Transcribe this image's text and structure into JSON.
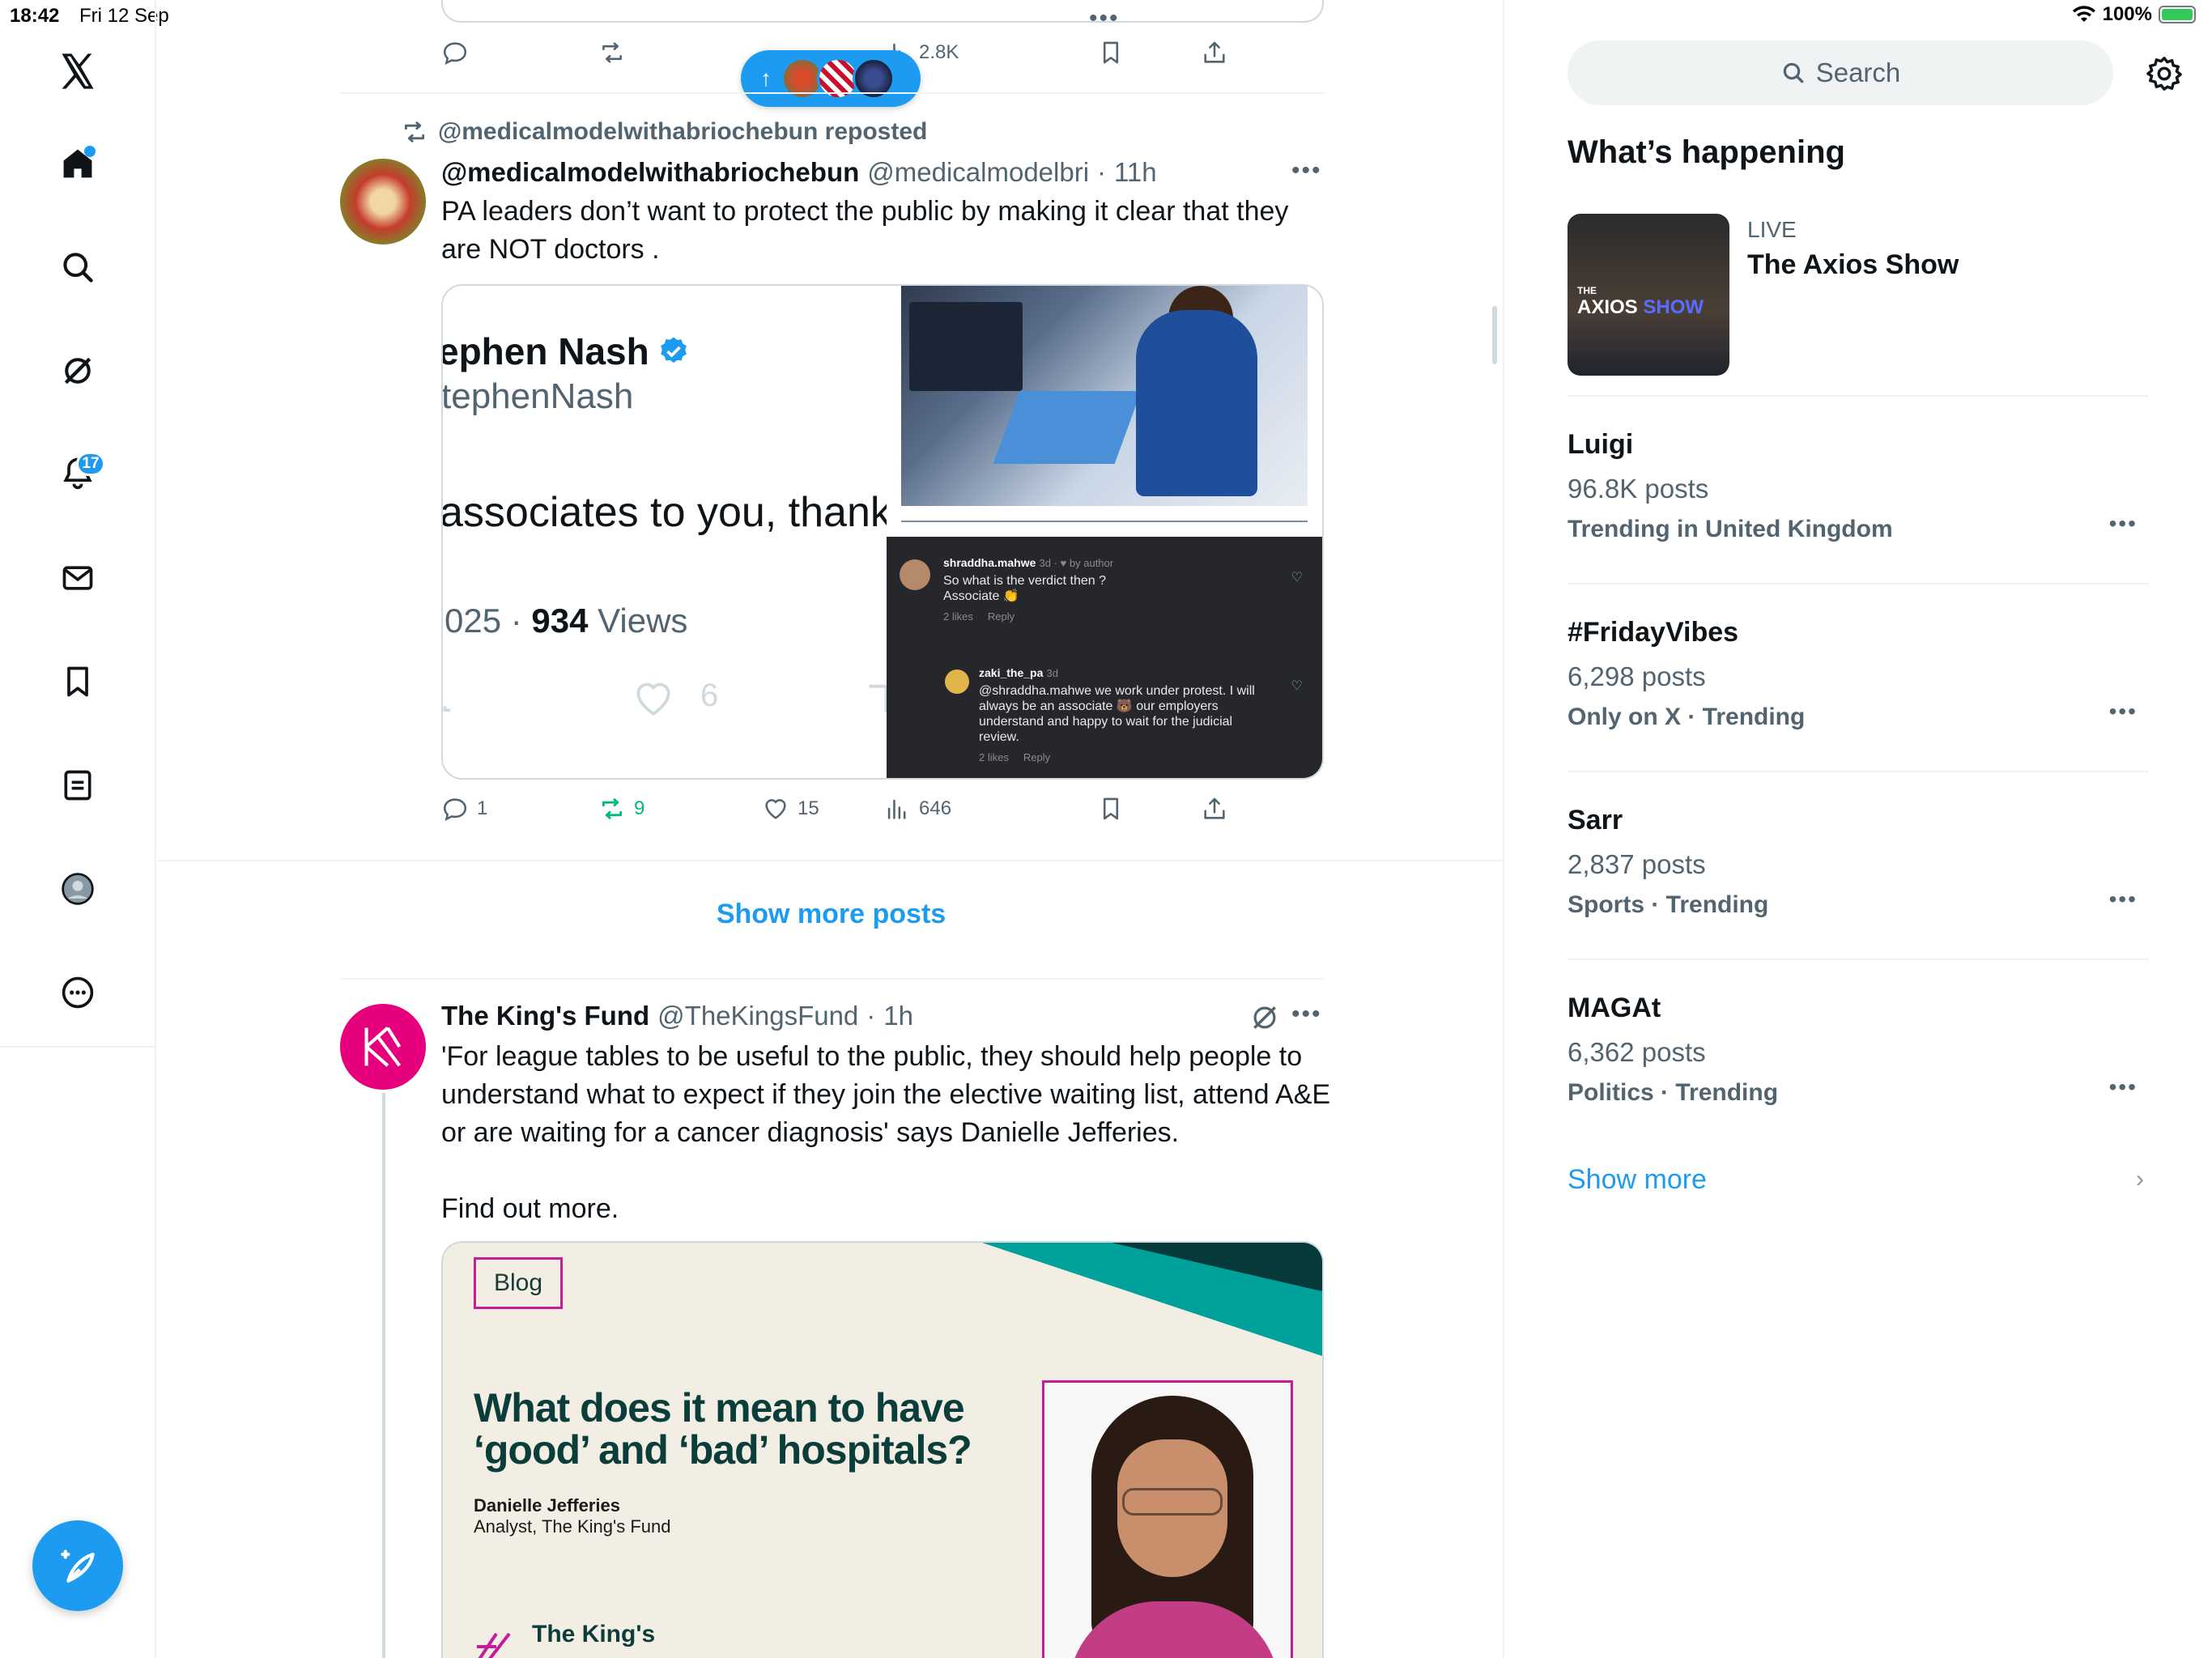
{
  "status_bar": {
    "time": "18:42",
    "date": "Fri 12 Sep",
    "battery": "100%"
  },
  "nav": {
    "logo": "x-logo-icon",
    "items": [
      {
        "name": "home",
        "icon": "home-icon"
      },
      {
        "name": "explore",
        "icon": "search-icon"
      },
      {
        "name": "grok",
        "icon": "grok-icon"
      },
      {
        "name": "notifications",
        "icon": "bell-icon",
        "badge": "17"
      },
      {
        "name": "messages",
        "icon": "mail-icon"
      },
      {
        "name": "bookmarks",
        "icon": "bookmark-icon"
      },
      {
        "name": "lists",
        "icon": "list-icon"
      },
      {
        "name": "profile",
        "icon": "profile-icon"
      },
      {
        "name": "more",
        "icon": "more-circle-icon"
      }
    ],
    "compose_icon": "compose-icon"
  },
  "prev_tweet_actions": {
    "views": "2.8K"
  },
  "repost_tweet": {
    "repost_label": "@medicalmodelwithabriochebun reposted",
    "name": "@medicalmodelwithabriochebun",
    "handle": "@medicalmodelbri",
    "time": "11h",
    "text": "PA leaders don’t want to protect the public by making it clear that they are NOT doctors .",
    "embedded": {
      "name": "ephen Nash",
      "handle": "tephenNash",
      "body": "associates to you, thanks",
      "meta_prefix": "025 · ",
      "views_num": "934",
      "views_label": " Views",
      "like_count": "6"
    },
    "comments": [
      {
        "user": "shraddha.mahwe",
        "meta": "3d · ♥ by author",
        "text": "So what is the verdict then ?\nAssociate 👏",
        "footer": "2 likes     Reply"
      },
      {
        "user": "zaki_the_pa",
        "meta": "3d",
        "text": "@shraddha.mahwe we work under protest. I will always be an associate 🐻 our employers understand and happy to wait for the judicial review.",
        "footer": "2 likes     Reply"
      }
    ],
    "actions": {
      "replies": "1",
      "reposts": "9",
      "likes": "15",
      "views": "646"
    }
  },
  "show_more_posts": "Show more posts",
  "kings_fund_tweet": {
    "name": "The King's Fund",
    "handle": "@TheKingsFund",
    "time": "1h",
    "text": "'For league tables to be useful to the public, they should help people to understand what to expect if they join the elective waiting list, attend A&E or are waiting for a cancer diagnosis' says Danielle Jefferies.\n\nFind out more.",
    "card": {
      "tag": "Blog",
      "title": "What does it mean to have ‘good’ and ‘bad’ hospitals?",
      "author": "Danielle Jefferies",
      "role": "Analyst, The King's Fund",
      "logo_text": "The King's"
    }
  },
  "right": {
    "search_placeholder": "Search",
    "whats_happening": "What’s happening",
    "live": {
      "label": "LIVE",
      "title": "The Axios Show",
      "thumb_brand": "AXIOS",
      "thumb_brand2": "SHOW",
      "thumb_the": "THE"
    },
    "trends": [
      {
        "name": "Luigi",
        "count": "96.8K posts",
        "context": "Trending in United Kingdom"
      },
      {
        "name": "#FridayVibes",
        "count": "6,298 posts",
        "context": "Only on X · Trending"
      },
      {
        "name": "Sarr",
        "count": "2,837 posts",
        "context": "Sports · Trending"
      },
      {
        "name": "MAGAt",
        "count": "6,362 posts",
        "context": "Politics · Trending"
      }
    ],
    "show_more": "Show more"
  },
  "colors": {
    "accent": "#1d9bf0",
    "repost_green": "#00ba7c",
    "text_primary": "#0f1419",
    "text_secondary": "#536471",
    "kings_fund_magenta": "#e6007e"
  }
}
